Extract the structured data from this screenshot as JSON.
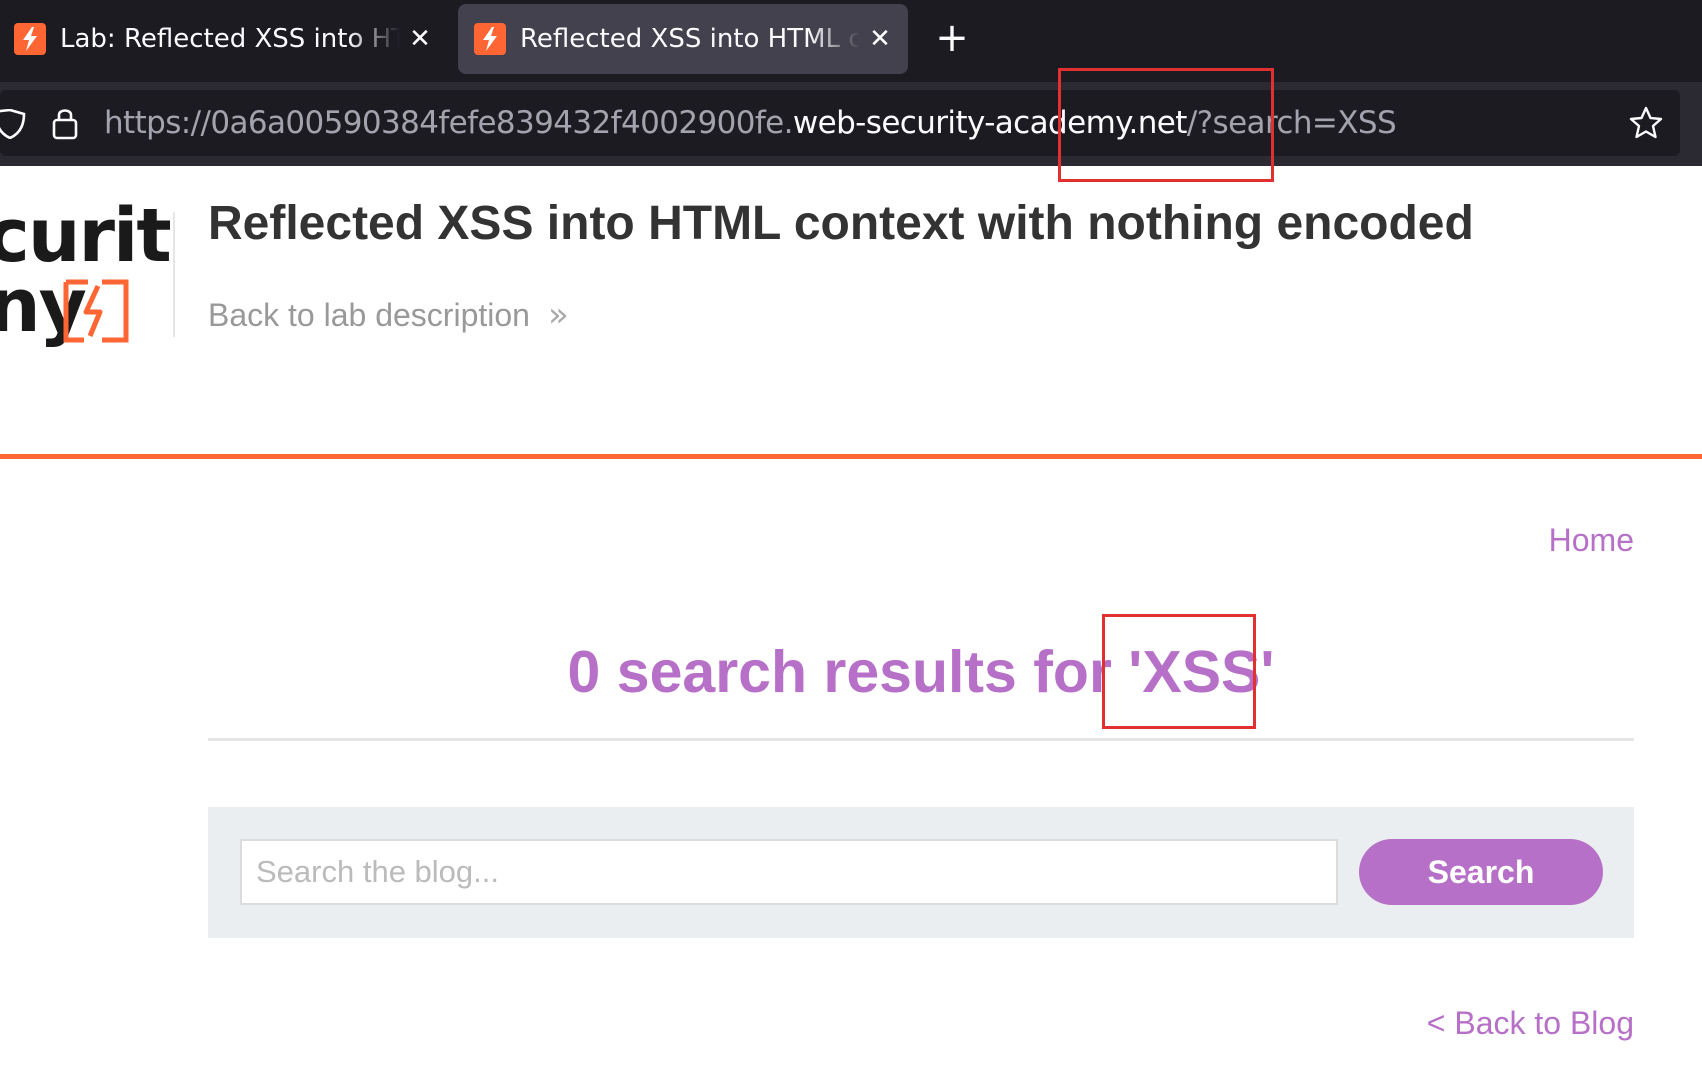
{
  "browser": {
    "tabs": [
      {
        "title": "Lab: Reflected XSS into HTML context with nothing encoded",
        "active": false
      },
      {
        "title": "Reflected XSS into HTML context with nothing encoded",
        "active": true
      }
    ],
    "tab_close_glyph": "✕",
    "new_tab_glyph": "+",
    "url": {
      "prefix": "https://0a6a00590384fefe839432f4002900fe.",
      "domain": "web-security-academy.net",
      "path": "/?search=XSS"
    }
  },
  "header": {
    "logo": {
      "line1": "curity",
      "line2": "ny"
    },
    "lab_title": "Reflected XSS into HTML context with nothing encoded",
    "back_to_lab": "Back to lab description",
    "chevron": "»"
  },
  "nav": {
    "home": "Home"
  },
  "results": {
    "text": "0 search results for 'XSS'"
  },
  "search": {
    "placeholder": "Search the blog...",
    "value": "",
    "button": "Search"
  },
  "footer": {
    "back_to_blog": "< Back to Blog"
  },
  "colors": {
    "accent_orange": "#ff6633",
    "link_purple": "#b770c7",
    "highlight_red": "#e03030"
  }
}
